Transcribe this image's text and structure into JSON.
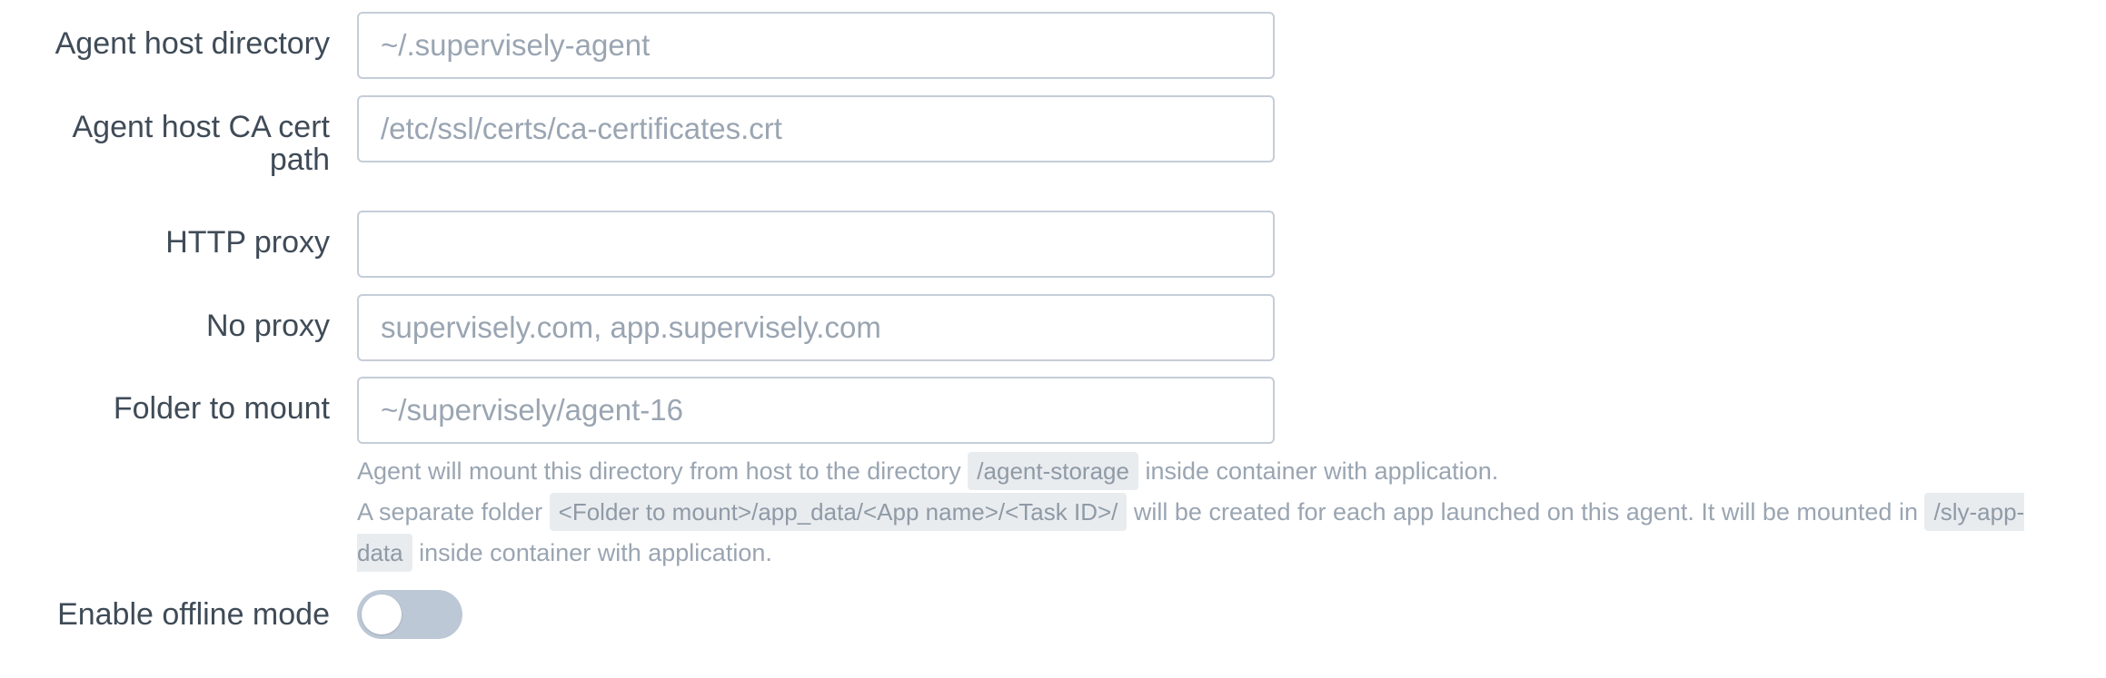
{
  "fields": {
    "agent_host_directory": {
      "label": "Agent host directory",
      "value": "",
      "placeholder": "~/.supervisely-agent"
    },
    "agent_host_ca_cert_path": {
      "label_line1": "Agent host CA cert",
      "label_line2": "path",
      "value": "",
      "placeholder": "/etc/ssl/certs/ca-certificates.crt"
    },
    "http_proxy": {
      "label": "HTTP proxy",
      "value": "",
      "placeholder": ""
    },
    "no_proxy": {
      "label": "No proxy",
      "value": "",
      "placeholder": "supervisely.com, app.supervisely.com"
    },
    "folder_to_mount": {
      "label": "Folder to mount",
      "value": "",
      "placeholder": "~/supervisely/agent-16",
      "help": {
        "line1_before": "Agent will mount this directory from host to the directory",
        "line1_code": "/agent-storage",
        "line1_after": "inside container with application.",
        "line2_before": "A separate folder",
        "line2_code1": "<Folder to mount>/app_data/<App name>/<Task ID>/",
        "line2_middle": "will be created for each app launched on this agent. It will be mounted in",
        "line2_code2": "/sly-app-data",
        "line2_after": "inside container with application."
      }
    },
    "enable_offline_mode": {
      "label": "Enable offline mode",
      "enabled": false
    }
  },
  "colors": {
    "label_text": "#3f4b57",
    "input_border": "#c5cdd7",
    "placeholder_text": "#9aa5b2",
    "help_text": "#9aa5b2",
    "code_background": "#e9ecef",
    "toggle_off": "#bdc8d6"
  }
}
